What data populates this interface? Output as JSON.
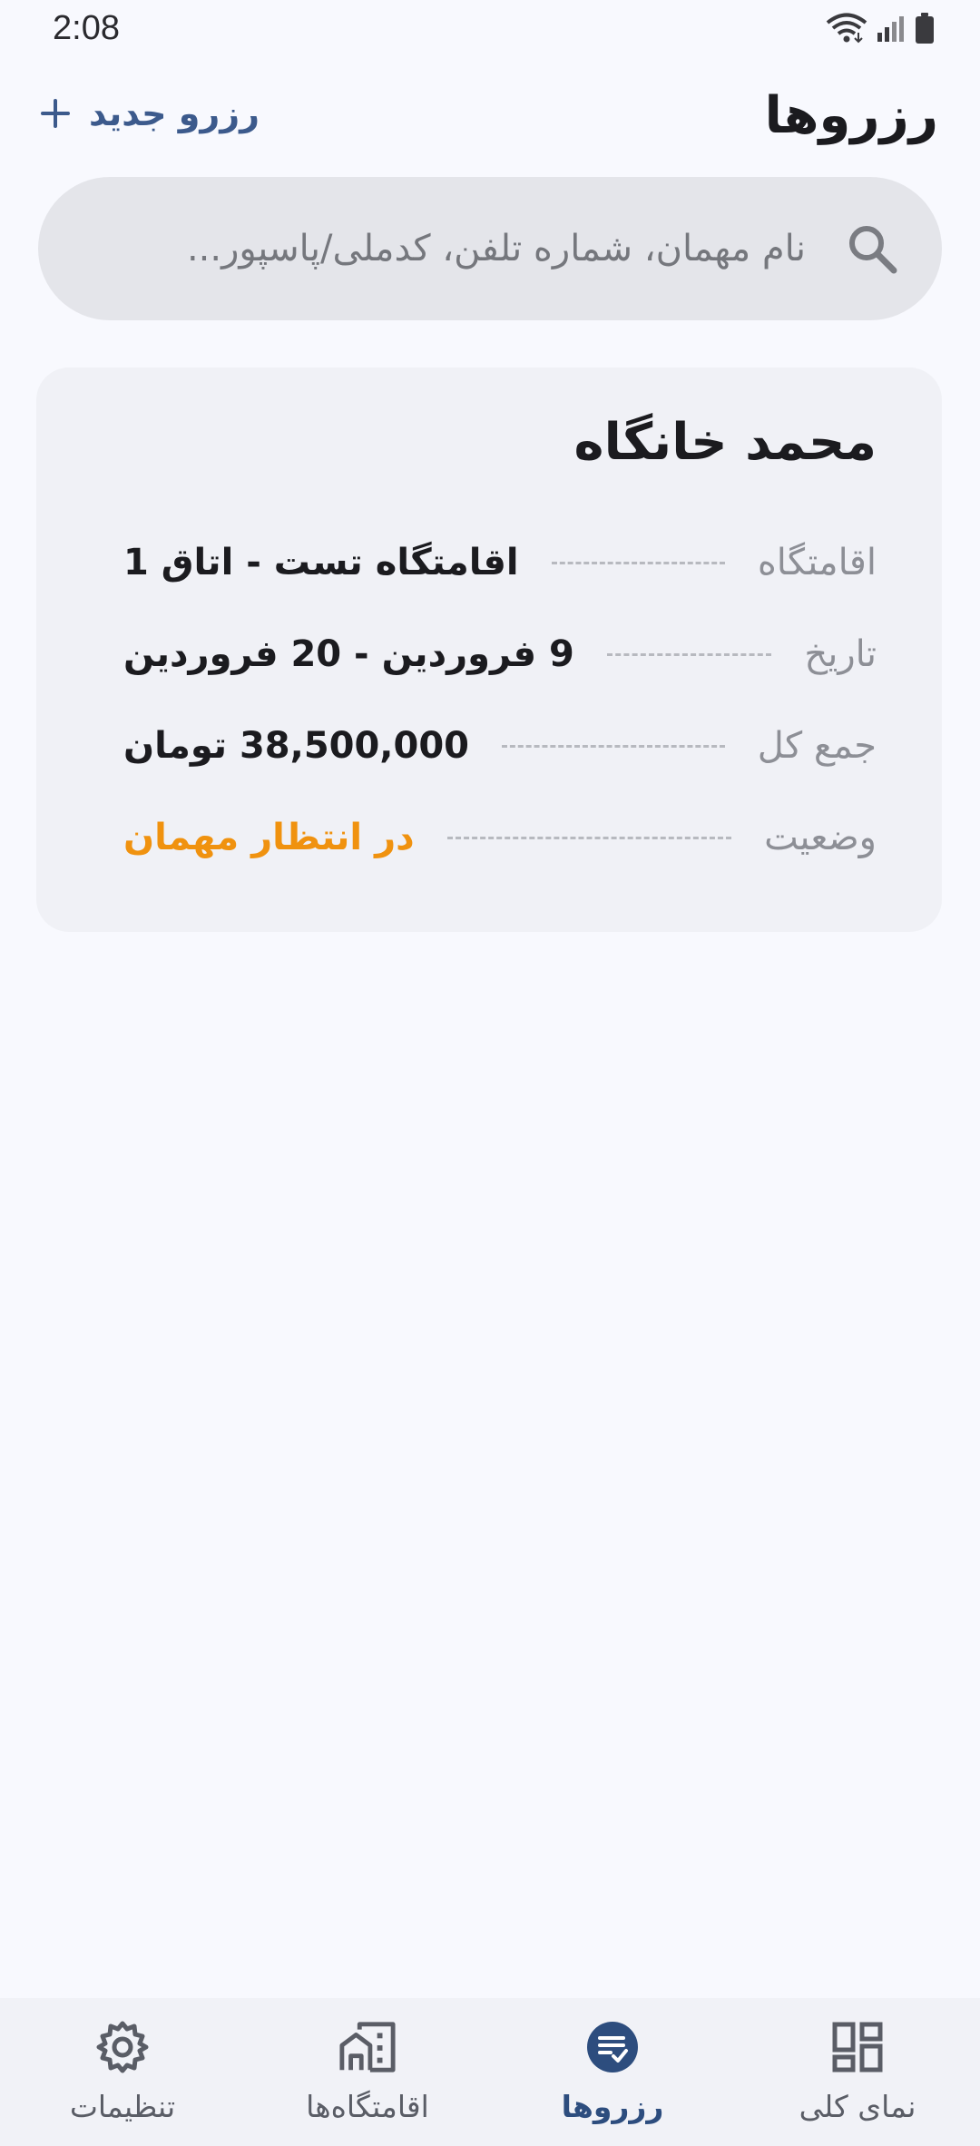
{
  "status_bar": {
    "time": "2:08"
  },
  "header": {
    "title": "رزروها",
    "new_button_label": "رزرو جدید"
  },
  "search": {
    "placeholder": "نام مهمان، شماره تلفن، کدملی/پاسپور..."
  },
  "reservation": {
    "guest_name": "محمد خانگاه",
    "rows": [
      {
        "label": "اقامتگاه",
        "value": "اقامتگاه تست - اتاق 1"
      },
      {
        "label": "تاریخ",
        "value": "9 فروردین - 20 فروردین"
      },
      {
        "label": "جمع کل",
        "value": "38,500,000 تومان"
      },
      {
        "label": "وضعیت",
        "value": "در انتظار مهمان"
      }
    ],
    "status_color": "#f0920f"
  },
  "bottom_nav": {
    "items": [
      {
        "label": "تنظیمات",
        "icon": "gear-icon"
      },
      {
        "label": "اقامتگاه‌ها",
        "icon": "building-icon"
      },
      {
        "label": "رزروها",
        "icon": "reservations-icon",
        "active": true
      },
      {
        "label": "نمای کلی",
        "icon": "dashboard-icon"
      }
    ]
  },
  "colors": {
    "accent": "#3c5a8c",
    "background": "#f8f9fe",
    "card": "#f0f1f6"
  }
}
